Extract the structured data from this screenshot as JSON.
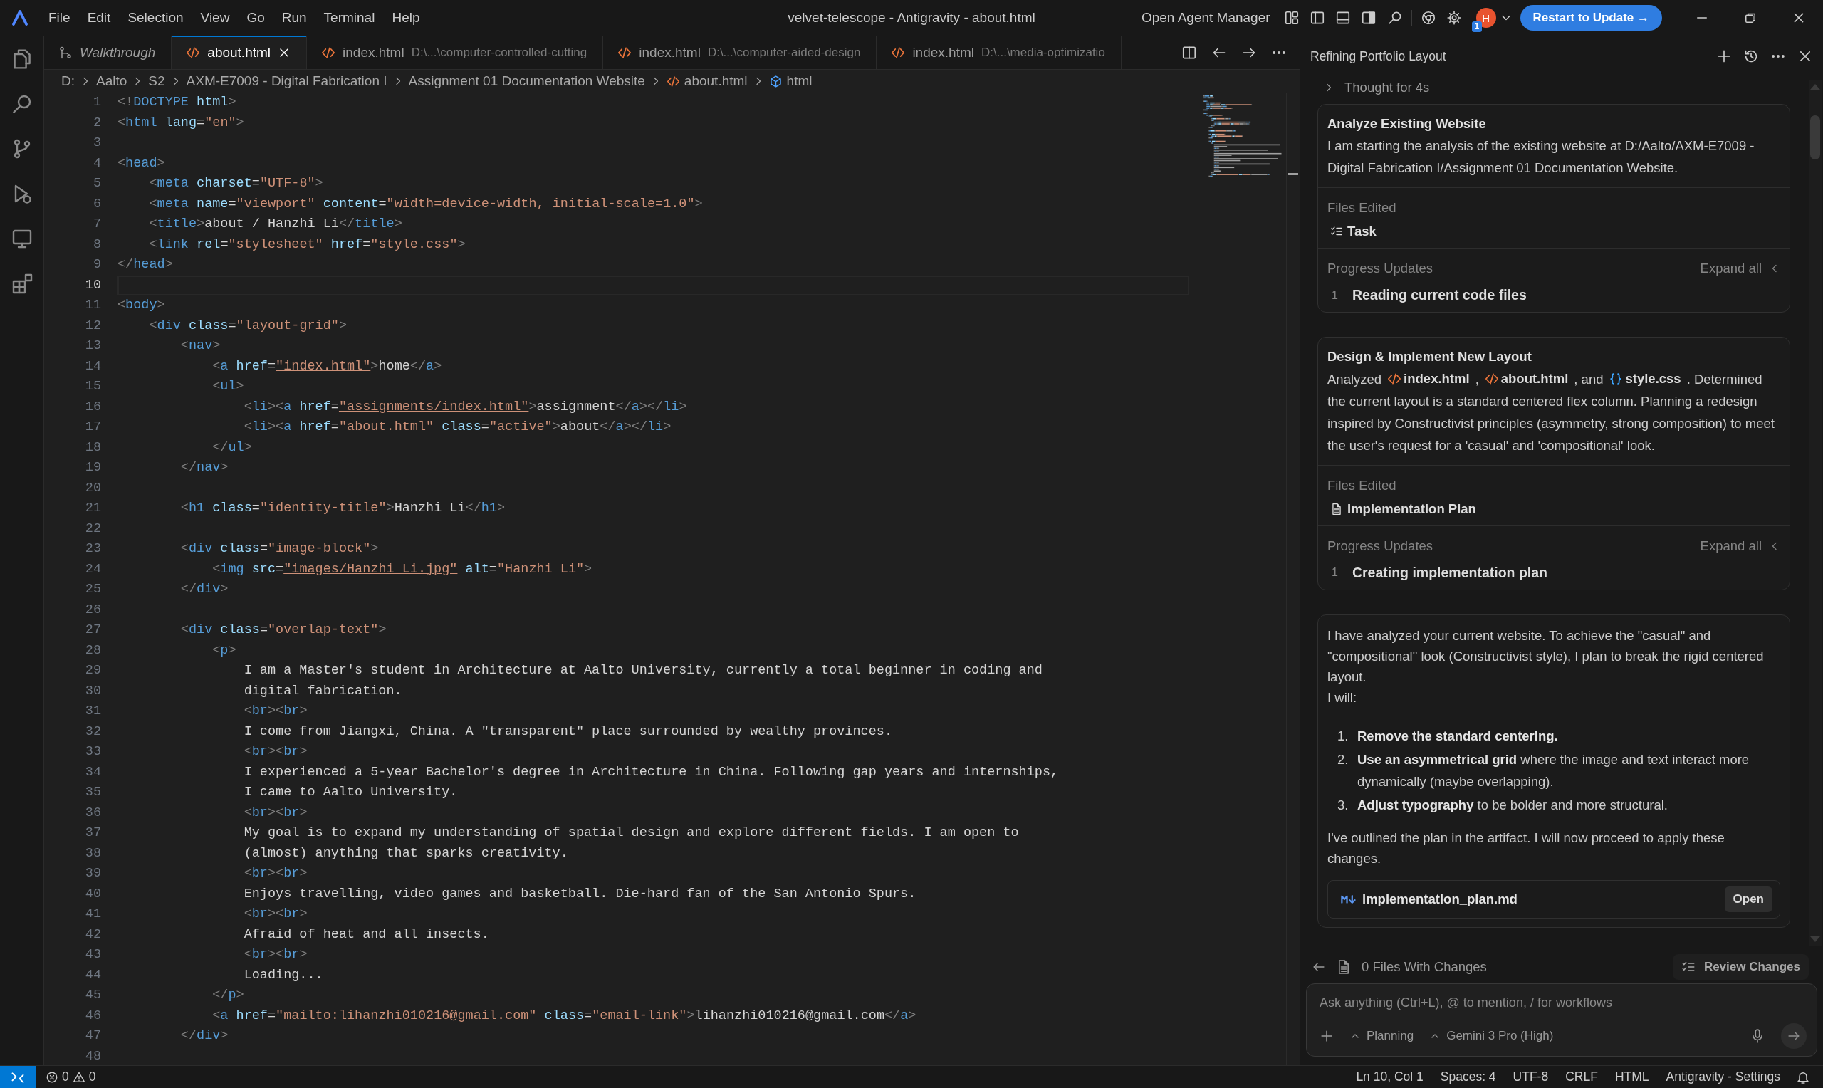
{
  "window": {
    "title": "velvet-telescope - Antigravity - about.html"
  },
  "menu": [
    "File",
    "Edit",
    "Selection",
    "View",
    "Go",
    "Run",
    "Terminal",
    "Help"
  ],
  "title_actions": {
    "agent_manager": "Open Agent Manager",
    "layout_toggles": [
      {
        "kind": "customize",
        "selected": false
      },
      {
        "kind": "primary-sidebar",
        "selected": false
      },
      {
        "kind": "panel",
        "selected": false
      },
      {
        "kind": "secondary-sidebar",
        "selected": true
      }
    ],
    "avatar": "H",
    "notification_count": "1",
    "update_button": "Restart to Update →"
  },
  "activity_bar": [
    {
      "kind": "explorer"
    },
    {
      "kind": "search"
    },
    {
      "kind": "source-control"
    },
    {
      "kind": "run-debug"
    },
    {
      "kind": "remote"
    },
    {
      "kind": "extensions"
    }
  ],
  "tabs": [
    {
      "kind": "walkthrough",
      "label": "Walkthrough",
      "selected": false
    },
    {
      "kind": "html",
      "label": "about.html",
      "selected": true
    },
    {
      "kind": "html",
      "label": "index.html",
      "path": "D:\\...\\computer-controlled-cutting",
      "selected": false
    },
    {
      "kind": "html",
      "label": "index.html",
      "path": "D:\\...\\computer-aided-design",
      "selected": false
    },
    {
      "kind": "html",
      "label": "index.html",
      "path": "D:\\...\\media-optimizatio",
      "selected": false
    }
  ],
  "breadcrumb": [
    {
      "kind": "folder",
      "label": "D:"
    },
    {
      "kind": "folder",
      "label": "Aalto"
    },
    {
      "kind": "folder",
      "label": "S2"
    },
    {
      "kind": "folder",
      "label": "AXM-E7009 - Digital Fabrication I"
    },
    {
      "kind": "folder",
      "label": "Assignment 01 Documentation Website"
    },
    {
      "kind": "html",
      "label": "about.html"
    },
    {
      "kind": "element",
      "label": "html"
    }
  ],
  "editor": {
    "lines": [
      {
        "number": "1",
        "current": false,
        "text": "<!DOCTYPE html>"
      },
      {
        "number": "2",
        "current": false,
        "text": "<html lang=\"en\">"
      },
      {
        "number": "3",
        "current": false
      },
      {
        "number": "4",
        "current": false,
        "text": "<head>"
      },
      {
        "number": "5",
        "current": false,
        "text": "    <meta charset=\"UTF-8\">"
      },
      {
        "number": "6",
        "current": false,
        "text": "    <meta name=\"viewport\" content=\"width=device-width, initial-scale=1.0\">"
      },
      {
        "number": "7",
        "current": false,
        "text": "    <title>about / Hanzhi Li</title>"
      },
      {
        "number": "8",
        "current": false,
        "text": "    <link rel=\"stylesheet\" href=\"style.css\">"
      },
      {
        "number": "9",
        "current": false,
        "text": "</head>"
      },
      {
        "number": "10",
        "current": true
      },
      {
        "number": "11",
        "current": false,
        "text": "<body>"
      },
      {
        "number": "12",
        "current": false,
        "text": "    <div class=\"layout-grid\">"
      },
      {
        "number": "13",
        "current": false,
        "text": "        <nav>"
      },
      {
        "number": "14",
        "current": false,
        "text": "            <a href=\"index.html\">home</a>"
      },
      {
        "number": "15",
        "current": false,
        "text": "            <ul>"
      },
      {
        "number": "16",
        "current": false,
        "text": "                <li><a href=\"assignments/index.html\">assignment</a></li>"
      },
      {
        "number": "17",
        "current": false,
        "text": "                <li><a href=\"about.html\" class=\"active\">about</a></li>"
      },
      {
        "number": "18",
        "current": false,
        "text": "            </ul>"
      },
      {
        "number": "19",
        "current": false,
        "text": "        </nav>"
      },
      {
        "number": "20",
        "current": false
      },
      {
        "number": "21",
        "current": false,
        "text": "        <h1 class=\"identity-title\">Hanzhi Li</h1>"
      },
      {
        "number": "22",
        "current": false
      },
      {
        "number": "23",
        "current": false,
        "text": "        <div class=\"image-block\">"
      },
      {
        "number": "24",
        "current": false,
        "text": "            <img src=\"images/Hanzhi Li.jpg\" alt=\"Hanzhi Li\">"
      },
      {
        "number": "25",
        "current": false,
        "text": "        </div>"
      },
      {
        "number": "26",
        "current": false
      },
      {
        "number": "27",
        "current": false,
        "text": "        <div class=\"overlap-text\">"
      },
      {
        "number": "28",
        "current": false,
        "text": "            <p>"
      },
      {
        "number": "29",
        "current": false,
        "text": "                I am a Master's student in Architecture at Aalto University, currently a total beginner in coding and"
      },
      {
        "number": "30",
        "current": false,
        "text": "                digital fabrication."
      },
      {
        "number": "31",
        "current": false,
        "text": "                <br><br>"
      },
      {
        "number": "32",
        "current": false,
        "text": "                I come from Jiangxi, China. A \"transparent\" place surrounded by wealthy provinces."
      },
      {
        "number": "33",
        "current": false,
        "text": "                <br><br>"
      },
      {
        "number": "34",
        "current": false,
        "text": "                I experienced a 5-year Bachelor's degree in Architecture in China. Following gap years and internships,"
      },
      {
        "number": "35",
        "current": false,
        "text": "                I came to Aalto University."
      },
      {
        "number": "36",
        "current": false,
        "text": "                <br><br>"
      },
      {
        "number": "37",
        "current": false,
        "text": "                My goal is to expand my understanding of spatial design and explore different fields. I am open to"
      },
      {
        "number": "38",
        "current": false,
        "text": "                (almost) anything that sparks creativity."
      },
      {
        "number": "39",
        "current": false,
        "text": "                <br><br>"
      },
      {
        "number": "40",
        "current": false,
        "text": "                Enjoys travelling, video games and basketball. Die-hard fan of the San Antonio Spurs."
      },
      {
        "number": "41",
        "current": false,
        "text": "                <br><br>"
      },
      {
        "number": "42",
        "current": false,
        "text": "                Afraid of heat and all insects."
      },
      {
        "number": "43",
        "current": false,
        "text": "                <br><br>"
      },
      {
        "number": "44",
        "current": false,
        "text": "                Loading..."
      },
      {
        "number": "45",
        "current": false,
        "text": "            </p>"
      },
      {
        "number": "46",
        "current": false,
        "text": "            <a href=\"mailto:lihanzhi010216@gmail.com\" class=\"email-link\">lihanzhi010216@gmail.com</a>"
      },
      {
        "number": "47",
        "current": false,
        "text": "        </div>"
      },
      {
        "number": "48",
        "current": false
      }
    ]
  },
  "agent_panel": {
    "title": "Refining Portfolio Layout",
    "thought": "Thought for 4s",
    "steps": [
      {
        "title": "Analyze Existing Website",
        "body": [
          {
            "kind": "text",
            "text": "I am starting the analysis of the existing website at D:/Aalto/AXM-E7009 - Digital Fabrication I/Assignment 01 Documentation Website."
          }
        ],
        "files_label": "Files Edited",
        "files": [
          {
            "kind": "task",
            "label": "Task"
          }
        ],
        "progress_label": "Progress Updates",
        "expand_label": "Expand all",
        "updates": [
          {
            "number": "1",
            "text": "Reading current code files"
          }
        ]
      },
      {
        "title": "Design & Implement New Layout",
        "body": [
          {
            "kind": "text",
            "text": "Analyzed"
          },
          {
            "kind": "html-file",
            "text": "index.html"
          },
          {
            "kind": "text",
            "text": ","
          },
          {
            "kind": "html-file",
            "text": "about.html"
          },
          {
            "kind": "text",
            "text": ", and"
          },
          {
            "kind": "css-file",
            "text": "style.css"
          },
          {
            "kind": "text",
            "text": ". Determined the current layout is a standard centered flex column. Planning a redesign inspired by Constructivist principles (asymmetry, strong composition) to meet the user's request for a 'casual' and 'compositional' look."
          }
        ],
        "files_label": "Files Edited",
        "files": [
          {
            "kind": "document",
            "label": "Implementation Plan"
          }
        ],
        "progress_label": "Progress Updates",
        "expand_label": "Expand all",
        "updates": [
          {
            "number": "1",
            "text": "Creating implementation plan"
          }
        ]
      }
    ],
    "summary": {
      "intro": [
        "I have analyzed your current website. To achieve the \"casual\" and \"compositional\" look (Constructivist style), I plan to break the rigid centered layout.",
        "I will:"
      ],
      "items": [
        {
          "number": "1.",
          "lead": "Remove the standard centering."
        },
        {
          "number": "2.",
          "lead": "Use an asymmetrical grid",
          "rest": "where the image and text interact more dynamically (maybe overlapping)."
        },
        {
          "number": "3.",
          "lead": "Adjust typography",
          "rest": "to be bolder and more structural."
        }
      ],
      "outro": "I've outlined the plan in the artifact. I will now proceed to apply these changes.",
      "artifact": {
        "name": "implementation_plan.md",
        "button": "Open"
      }
    },
    "changes": {
      "label": "0 Files With Changes",
      "review_button": "Review Changes"
    },
    "composer": {
      "placeholder": "Ask anything (Ctrl+L), @ to mention, / for workflows",
      "mode": "Planning",
      "model": "Gemini 3 Pro (High)"
    }
  },
  "status_bar": {
    "errors": "0",
    "warnings": "0",
    "items": [
      "Ln 10, Col 1",
      "Spaces: 4",
      "UTF-8",
      "CRLF",
      "HTML",
      "Antigravity - Settings"
    ]
  }
}
